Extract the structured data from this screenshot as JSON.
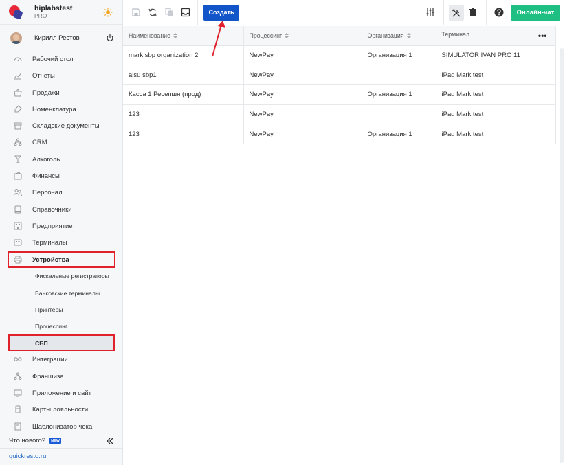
{
  "brand": {
    "name": "hiplabstest",
    "plan": "PRO"
  },
  "user": {
    "name": "Кирилл Рестов"
  },
  "sidebar": {
    "items": [
      {
        "label": "Рабочий стол",
        "icon": "dashboard-icon"
      },
      {
        "label": "Отчеты",
        "icon": "chart-icon"
      },
      {
        "label": "Продажи",
        "icon": "basket-icon"
      },
      {
        "label": "Номенклатура",
        "icon": "tag-icon"
      },
      {
        "label": "Складские документы",
        "icon": "box-icon"
      },
      {
        "label": "CRM",
        "icon": "people-tree-icon"
      },
      {
        "label": "Алкоголь",
        "icon": "glass-icon"
      },
      {
        "label": "Финансы",
        "icon": "wallet-icon"
      },
      {
        "label": "Персонал",
        "icon": "staff-icon"
      },
      {
        "label": "Справочники",
        "icon": "book-icon"
      },
      {
        "label": "Предприятие",
        "icon": "building-icon"
      },
      {
        "label": "Терминалы",
        "icon": "terminal-icon"
      },
      {
        "label": "Устройства",
        "icon": "printer-icon"
      }
    ],
    "sub_items": [
      {
        "label": "Фискальные регистраторы"
      },
      {
        "label": "Банковские терминалы"
      },
      {
        "label": "Принтеры"
      },
      {
        "label": "Процессинг"
      },
      {
        "label": "СБП"
      }
    ],
    "items_after": [
      {
        "label": "Интеграции",
        "icon": "infinity-icon"
      },
      {
        "label": "Франшиза",
        "icon": "franchise-icon"
      },
      {
        "label": "Приложение и сайт",
        "icon": "monitor-icon"
      },
      {
        "label": "Карты лояльности",
        "icon": "card-icon"
      },
      {
        "label": "Шаблонизатор чека",
        "icon": "receipt-icon"
      }
    ],
    "whats_new": "Что нового?",
    "new_badge": "NEW",
    "domain": "quickresto.ru"
  },
  "toolbar": {
    "create_label": "Создать",
    "chat_label": "Онлайн-чат"
  },
  "table": {
    "columns": [
      "Наименование",
      "Процессинг",
      "Организация",
      "Терминал"
    ],
    "rows": [
      [
        "mark sbp organization 2",
        "NewPay",
        "Организация 1",
        "SIMULATOR IVAN PRO 11"
      ],
      [
        "alsu sbp1",
        "NewPay",
        "",
        "iPad Mark test"
      ],
      [
        "Касса 1 Ресепшн (прод)",
        "NewPay",
        "Организация 1",
        "iPad Mark test"
      ],
      [
        "123",
        "NewPay",
        "",
        "iPad Mark test"
      ],
      [
        "123",
        "NewPay",
        "Организация 1",
        "iPad Mark test"
      ]
    ]
  },
  "colors": {
    "accent": "#1255c9",
    "chat": "#1fbf83",
    "highlight": "#e0202a"
  }
}
